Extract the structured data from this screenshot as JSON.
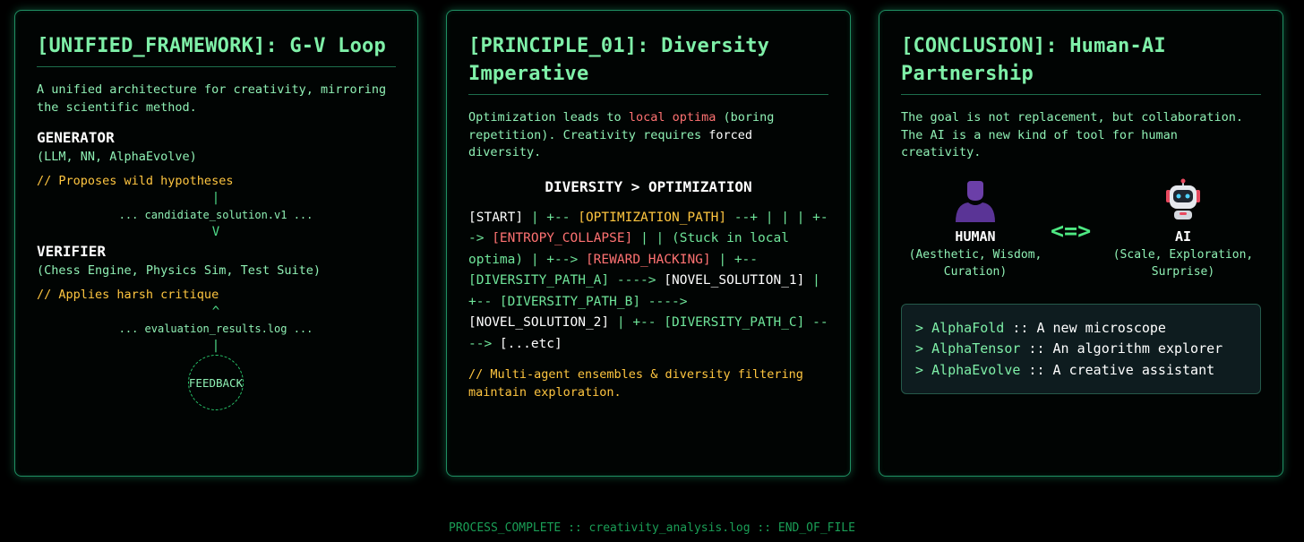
{
  "panel1": {
    "title": "[UNIFIED_FRAMEWORK]: G-V Loop",
    "intro": "A unified architecture for creativity, mirroring the scientific method.",
    "generator_label": "GENERATOR",
    "generator_examples": "(LLM, NN, AlphaEvolve)",
    "generator_comment": "// Proposes wild hypotheses",
    "pipe_top": "|",
    "candidate_line": "... candidiate_solution.v1 ...",
    "arrow_down": "V",
    "verifier_label": "VERIFIER",
    "verifier_examples": "(Chess Engine, Physics Sim, Test Suite)",
    "verifier_comment": "// Applies harsh critique",
    "arrow_up": "^",
    "eval_line": "... evaluation_results.log ...",
    "pipe_bottom": "|",
    "feedback": "FEEDBACK"
  },
  "panel2": {
    "title": "[PRINCIPLE_01]: Diversity Imperative",
    "intro_a": "Optimization leads to ",
    "intro_red": "local optima",
    "intro_b": " (boring repetition). Creativity requires ",
    "intro_white": "forced",
    "intro_c": " diversity.",
    "headline": "DIVERSITY > OPTIMIZATION",
    "flow": [
      {
        "text": "[START]",
        "color": "white"
      },
      {
        "text": " | +-- ",
        "color": "green"
      },
      {
        "text": "[OPTIMIZATION_PATH]",
        "color": "yellow"
      },
      {
        "text": " --+ | | | +--> ",
        "color": "green"
      },
      {
        "text": "[ENTROPY_COLLAPSE]",
        "color": "red"
      },
      {
        "text": " | | (Stuck in local optima) | +--> ",
        "color": "green"
      },
      {
        "text": "[REWARD_HACKING]",
        "color": "red"
      },
      {
        "text": " | +-- [DIVERSITY_PATH_A] ----> ",
        "color": "green"
      },
      {
        "text": "[NOVEL_SOLUTION_1]",
        "color": "white"
      },
      {
        "text": " | +-- [DIVERSITY_PATH_B] ----> ",
        "color": "green"
      },
      {
        "text": "[NOVEL_SOLUTION_2]",
        "color": "white"
      },
      {
        "text": " | +-- [DIVERSITY_PATH_C] ----> ",
        "color": "green"
      },
      {
        "text": "[...etc]",
        "color": "white"
      }
    ],
    "comment": "// Multi-agent ensembles & diversity filtering maintain exploration."
  },
  "panel3": {
    "title": "[CONCLUSION]: Human-AI Partnership",
    "intro": "The goal is not replacement, but collaboration. The AI is a new kind of tool for human creativity.",
    "human_icon": "person-icon",
    "human_label": "HUMAN",
    "human_desc": "(Aesthetic, Wisdom, Curation)",
    "connector": "<=>",
    "ai_icon": "robot-icon",
    "ai_label": "AI",
    "ai_desc": "(Scale, Exploration, Surprise)",
    "examples": [
      {
        "name": "AlphaFold",
        "desc": "A new microscope"
      },
      {
        "name": "AlphaTensor",
        "desc": "An algorithm explorer"
      },
      {
        "name": "AlphaEvolve",
        "desc": "A creative assistant"
      }
    ]
  },
  "footer": "PROCESS_COMPLETE :: creativity_analysis.log :: END_OF_FILE",
  "colors": {
    "accent_green": "#7ff0a8",
    "highlight_red": "#ff7272",
    "comment_yellow": "#ffc640",
    "border": "#1f8f62"
  }
}
